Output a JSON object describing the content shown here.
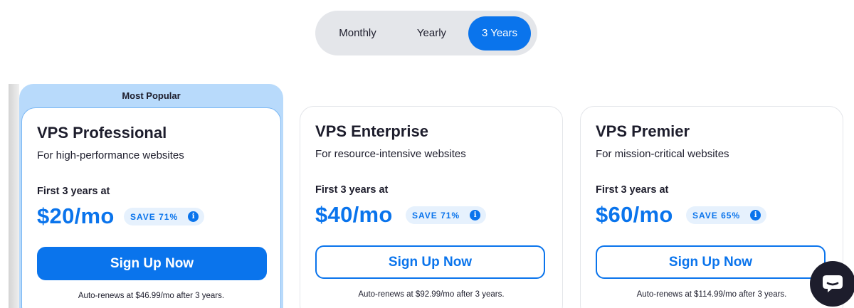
{
  "billing_toggle": {
    "options": [
      "Monthly",
      "Yearly",
      "3 Years"
    ],
    "selected": "3 Years"
  },
  "badge": {
    "most_popular": "Most Popular"
  },
  "plans": [
    {
      "name": "VPS Professional",
      "description": "For high-performance websites",
      "term": "First 3 years at",
      "price": "$20/mo",
      "save": "SAVE 71%",
      "cta": "Sign Up Now",
      "renewal": "Auto-renews at $46.99/mo after 3 years."
    },
    {
      "name": "VPS Enterprise",
      "description": "For resource-intensive websites",
      "term": "First 3 years at",
      "price": "$40/mo",
      "save": "SAVE 71%",
      "cta": "Sign Up Now",
      "renewal": "Auto-renews at $92.99/mo after 3 years."
    },
    {
      "name": "VPS Premier",
      "description": "For mission-critical websites",
      "term": "First 3 years at",
      "price": "$60/mo",
      "save": "SAVE 65%",
      "cta": "Sign Up Now",
      "renewal": "Auto-renews at $114.99/mo after 3 years."
    }
  ],
  "icons": {
    "info": "info-icon",
    "chat": "chat-bubble-icon"
  },
  "colors": {
    "accent": "#0a74ec",
    "popular_banner": "#b8dafb",
    "toggle_bg": "#e4e6ea",
    "text": "#1d1d2c"
  }
}
